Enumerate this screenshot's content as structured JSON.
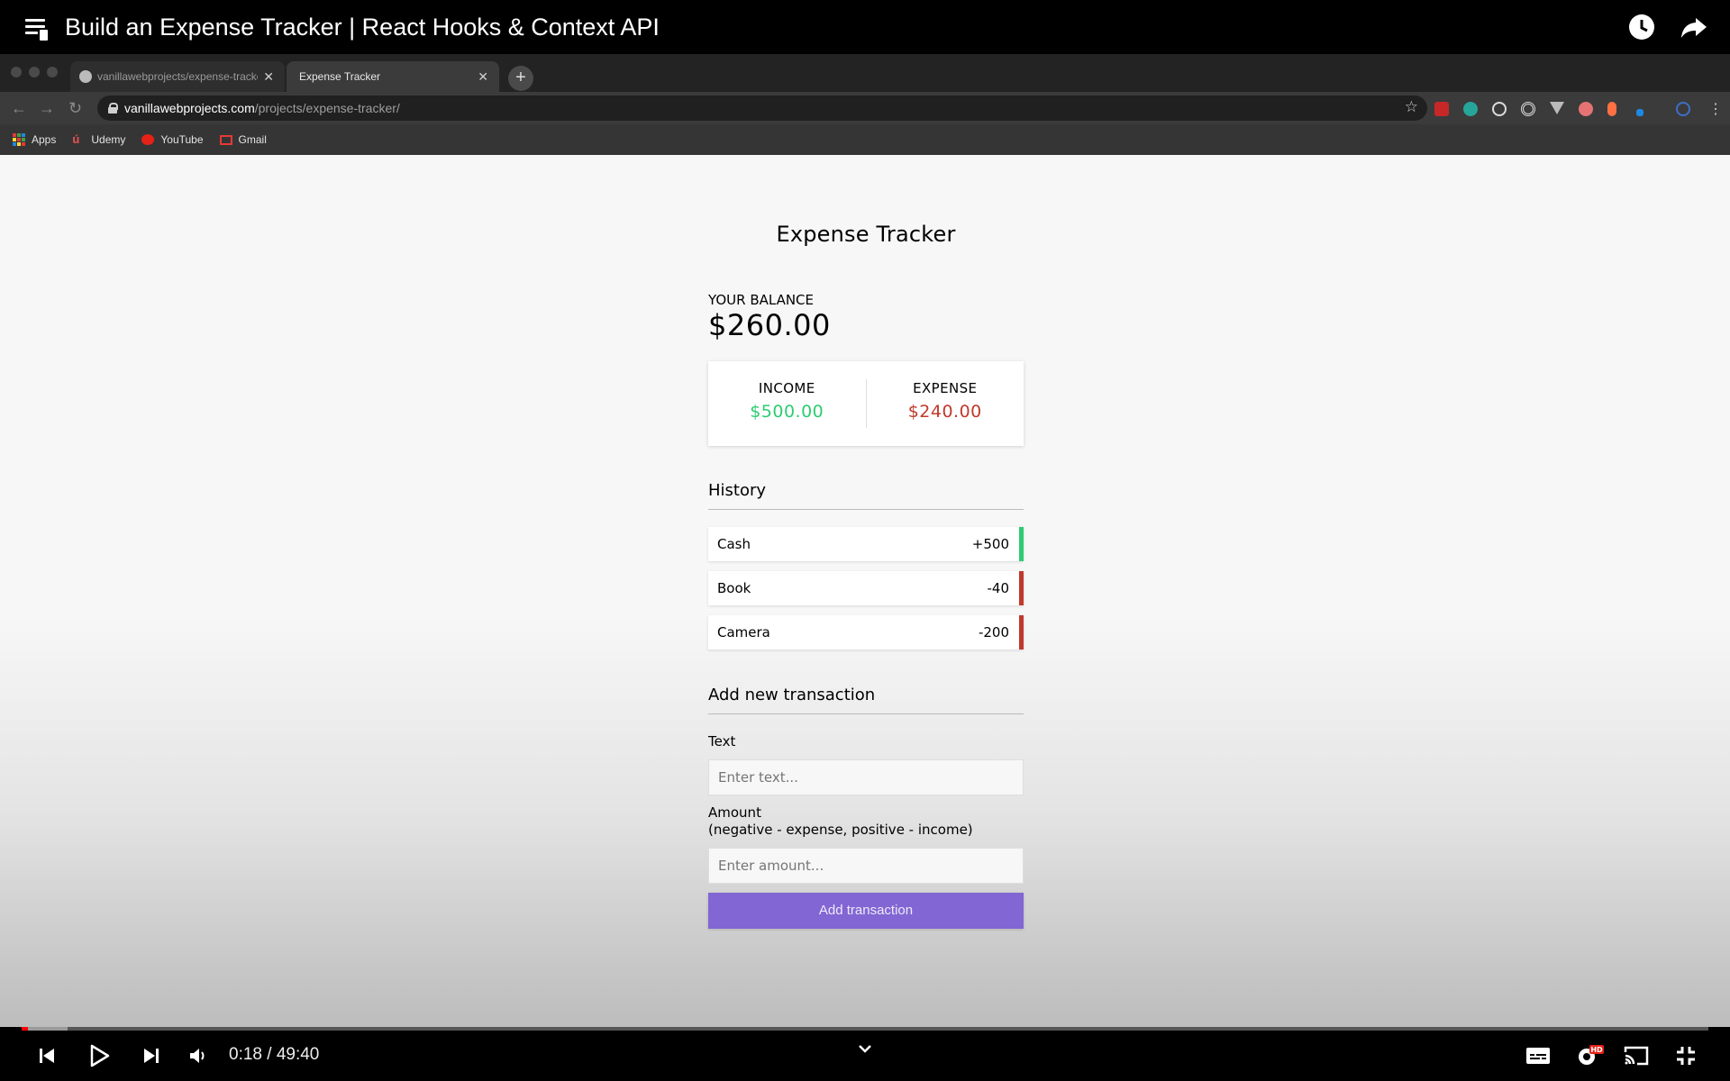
{
  "video": {
    "title": "Build an Expense Tracker | React Hooks & Context API",
    "time": "0:18 / 49:40",
    "progress_played_fraction": 0.004,
    "progress_buffered_fraction": 0.027
  },
  "browser": {
    "tabs": [
      {
        "label": "vanillawebprojects/expense-tracker",
        "active": false
      },
      {
        "label": "Expense Tracker",
        "active": true
      }
    ],
    "url_domain": "vanillawebprojects.com",
    "url_path": "/projects/expense-tracker/",
    "bookmarks": [
      {
        "label": "Apps",
        "icon": "apps-grid-icon"
      },
      {
        "label": "Udemy",
        "icon": "udemy-icon"
      },
      {
        "label": "YouTube",
        "icon": "youtube-icon"
      },
      {
        "label": "Gmail",
        "icon": "gmail-icon"
      }
    ]
  },
  "app": {
    "title": "Expense Tracker",
    "balance_label": "YOUR BALANCE",
    "balance": "$260.00",
    "income_label": "INCOME",
    "income": "$500.00",
    "expense_label": "EXPENSE",
    "expense": "$240.00",
    "history_title": "History",
    "transactions": [
      {
        "text": "Cash",
        "amount": "+500",
        "type": "plus"
      },
      {
        "text": "Book",
        "amount": "-40",
        "type": "minus"
      },
      {
        "text": "Camera",
        "amount": "-200",
        "type": "minus"
      }
    ],
    "form_title": "Add new transaction",
    "text_label": "Text",
    "text_placeholder": "Enter text...",
    "amount_label": "Amount",
    "amount_hint": "(negative - expense, positive - income)",
    "amount_placeholder": "Enter amount...",
    "submit_label": "Add transaction"
  },
  "colors": {
    "income": "#2ecc71",
    "expense": "#c0392b",
    "button": "#8266d4"
  }
}
